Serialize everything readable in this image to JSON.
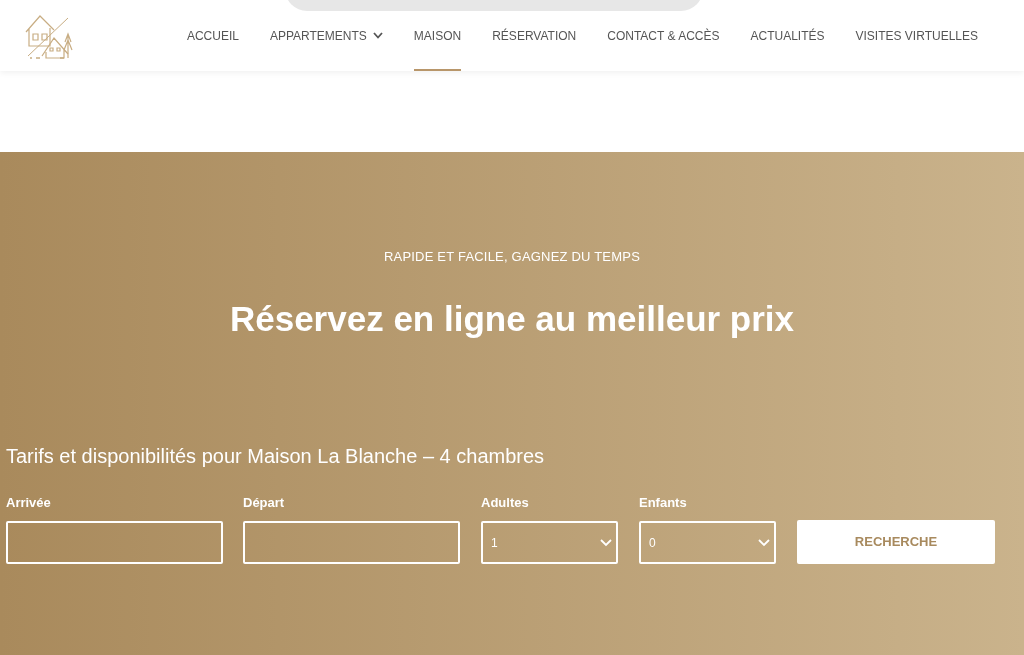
{
  "header": {
    "nav": [
      {
        "label": "ACCUEIL",
        "selected": false,
        "has_dropdown": false
      },
      {
        "label": "APPARTEMENTS",
        "selected": false,
        "has_dropdown": true
      },
      {
        "label": "MAISON",
        "selected": true,
        "has_dropdown": false
      },
      {
        "label": "RÉSERVATION",
        "selected": false,
        "has_dropdown": false
      },
      {
        "label": "CONTACT & ACCÈS",
        "selected": false,
        "has_dropdown": false
      },
      {
        "label": "ACTUALITÉS",
        "selected": false,
        "has_dropdown": false
      },
      {
        "label": "VISITES VIRTUELLES",
        "selected": false,
        "has_dropdown": false
      }
    ]
  },
  "hero": {
    "eyebrow": "RAPIDE ET FACILE, GAGNEZ DU TEMPS",
    "title": "Réservez en ligne au meilleur prix"
  },
  "booking": {
    "title": "Tarifs et disponibilités pour Maison La Blanche – 4 chambres",
    "fields": [
      {
        "kind": "input",
        "label": "Arrivée"
      },
      {
        "kind": "input",
        "label": "Départ"
      },
      {
        "kind": "select",
        "label": "Adultes",
        "value": "1"
      },
      {
        "kind": "select",
        "label": "Enfants",
        "value": "0"
      }
    ],
    "button": {
      "label": "RECHERCHE"
    }
  }
}
